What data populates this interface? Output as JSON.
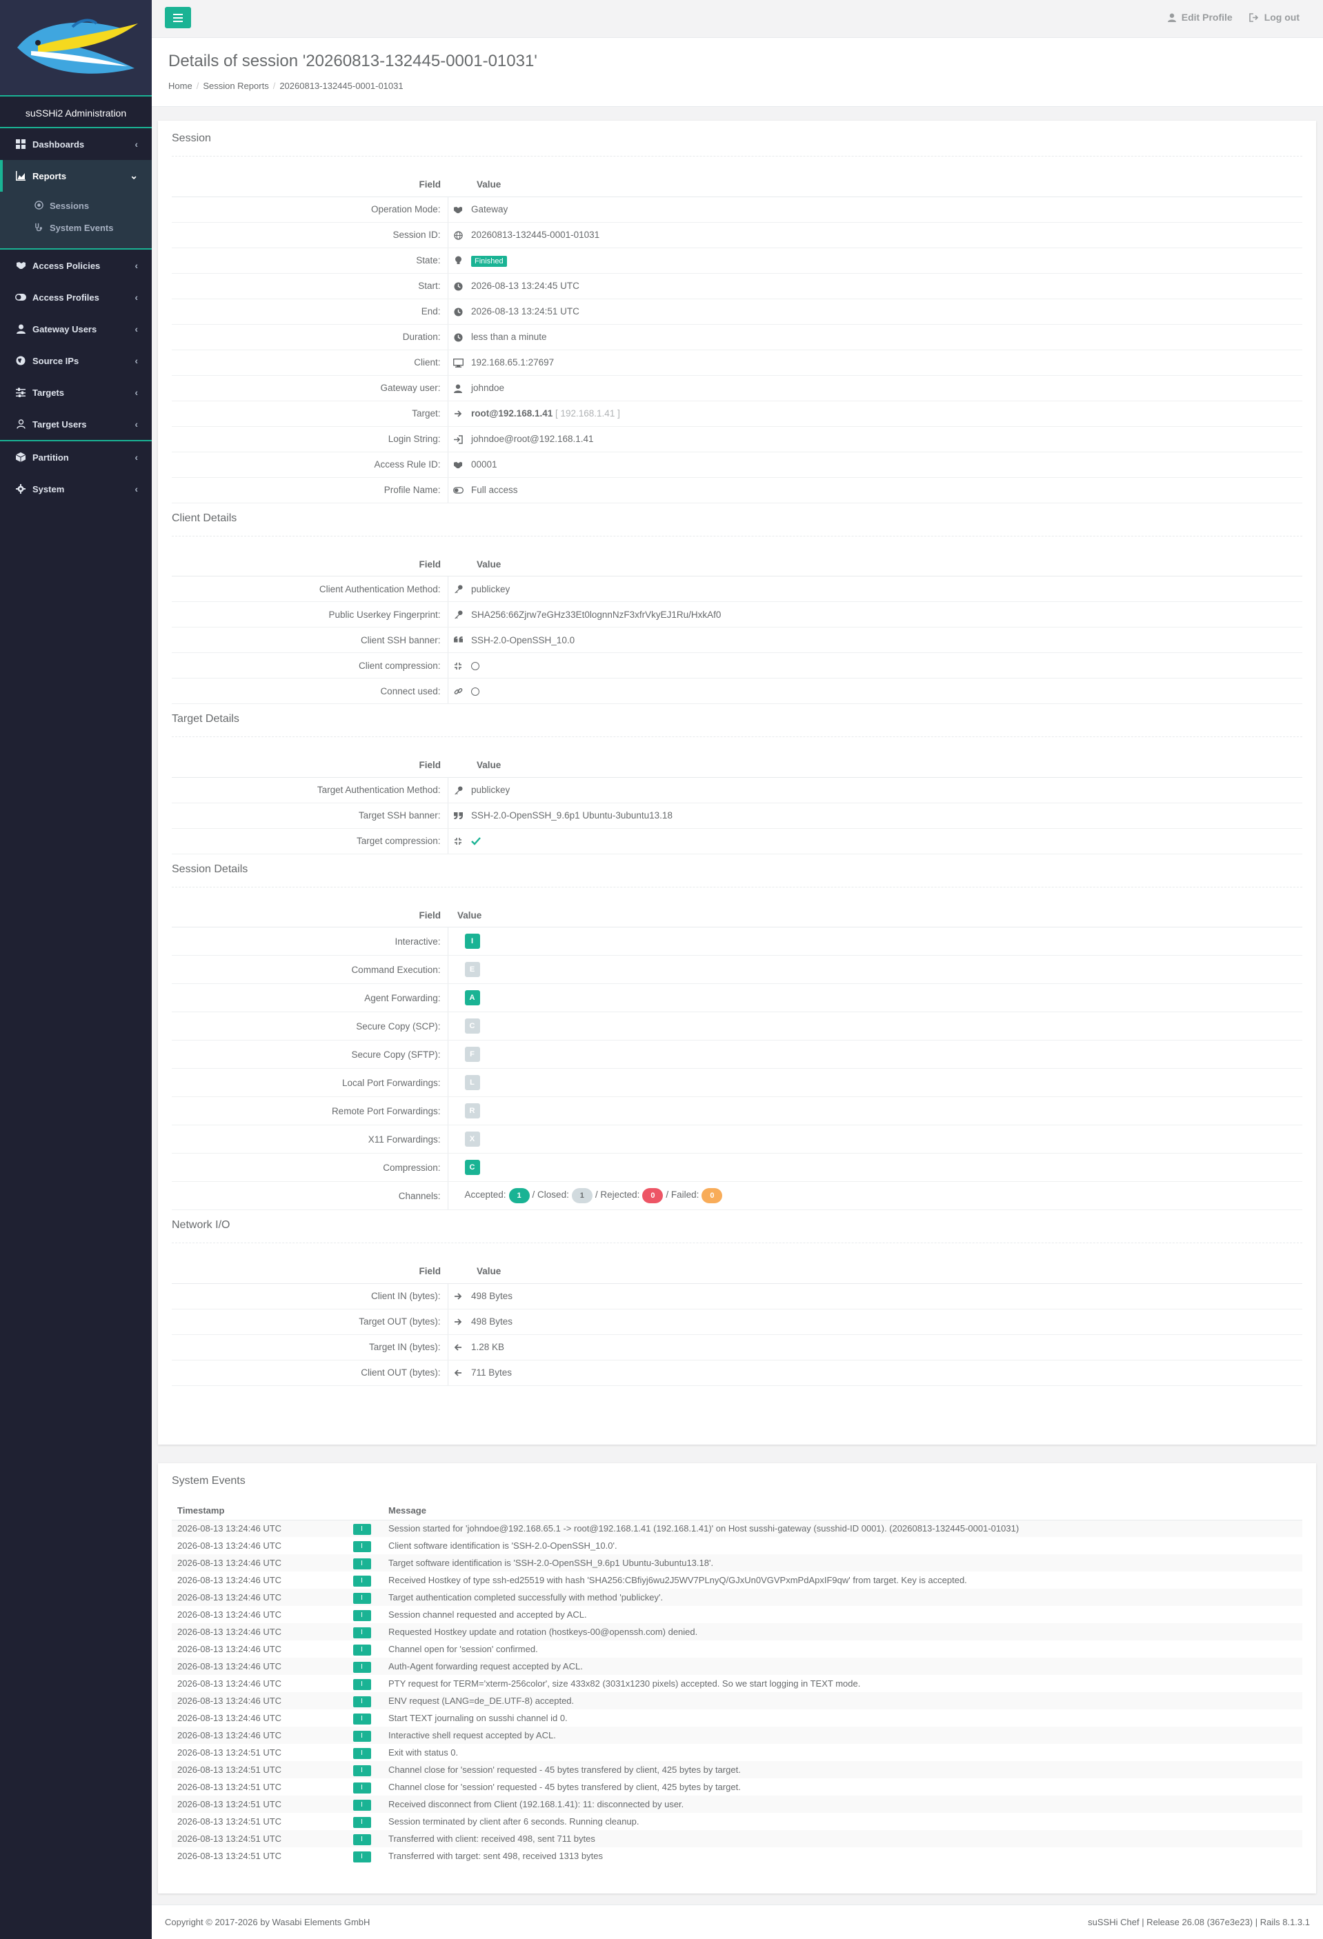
{
  "sidebar": {
    "admin_title": "suSSHi2 Administration",
    "items": {
      "dashboards": "Dashboards",
      "reports": "Reports",
      "sessions": "Sessions",
      "system_events": "System Events",
      "access_policies": "Access Policies",
      "access_profiles": "Access Profiles",
      "gateway_users": "Gateway Users",
      "source_ips": "Source IPs",
      "targets": "Targets",
      "target_users": "Target Users",
      "partition": "Partition",
      "system": "System"
    }
  },
  "topbar": {
    "edit_profile": "Edit Profile",
    "logout": "Log out"
  },
  "heading": {
    "title": "Details of session '20260813-132445-0001-01031'",
    "breadcrumb": [
      "Home",
      "Session Reports",
      "20260813-132445-0001-01031"
    ]
  },
  "table_headers": {
    "field": "Field",
    "value": "Value"
  },
  "session": {
    "title": "Session",
    "rows": [
      {
        "field": "Operation Mode:",
        "value": "Gateway"
      },
      {
        "field": "Session ID:",
        "value": "20260813-132445-0001-01031"
      },
      {
        "field": "State:",
        "value": "Finished"
      },
      {
        "field": "Start:",
        "value": "2026-08-13 13:24:45 UTC"
      },
      {
        "field": "End:",
        "value": "2026-08-13 13:24:51 UTC"
      },
      {
        "field": "Duration:",
        "value": "less than a minute"
      },
      {
        "field": "Client:",
        "value": "192.168.65.1:27697"
      },
      {
        "field": "Gateway user:",
        "value": "johndoe"
      },
      {
        "field": "Target:",
        "value": "root@192.168.1.41",
        "extra": "[ 192.168.1.41 ]"
      },
      {
        "field": "Login String:",
        "value": "johndoe@root@192.168.1.41"
      },
      {
        "field": "Access Rule ID:",
        "value": "00001"
      },
      {
        "field": "Profile Name:",
        "value": "Full access"
      }
    ]
  },
  "client_details": {
    "title": "Client Details",
    "rows": [
      {
        "field": "Client Authentication Method:",
        "value": "publickey"
      },
      {
        "field": "Public Userkey Fingerprint:",
        "value": "SHA256:66Zjrw7eGHz33Et0lognnNzF3xfrVkyEJ1Ru/HxkAf0"
      },
      {
        "field": "Client SSH banner:",
        "value": "SSH-2.0-OpenSSH_10.0"
      },
      {
        "field": "Client compression:",
        "value": ""
      },
      {
        "field": "Connect used:",
        "value": ""
      }
    ]
  },
  "target_details": {
    "title": "Target Details",
    "rows": [
      {
        "field": "Target Authentication Method:",
        "value": "publickey"
      },
      {
        "field": "Target SSH banner:",
        "value": "SSH-2.0-OpenSSH_9.6p1 Ubuntu-3ubuntu13.18"
      },
      {
        "field": "Target compression:",
        "value": ""
      }
    ]
  },
  "session_details": {
    "title": "Session Details",
    "rows": [
      {
        "field": "Interactive:",
        "flag": "I",
        "active": true
      },
      {
        "field": "Command Execution:",
        "flag": "E",
        "active": false
      },
      {
        "field": "Agent Forwarding:",
        "flag": "A",
        "active": true
      },
      {
        "field": "Secure Copy (SCP):",
        "flag": "C",
        "active": false
      },
      {
        "field": "Secure Copy (SFTP):",
        "flag": "F",
        "active": false
      },
      {
        "field": "Local Port Forwardings:",
        "flag": "L",
        "active": false
      },
      {
        "field": "Remote Port Forwardings:",
        "flag": "R",
        "active": false
      },
      {
        "field": "X11 Forwardings:",
        "flag": "X",
        "active": false
      },
      {
        "field": "Compression:",
        "flag": "C",
        "active": true
      }
    ],
    "channels": {
      "field": "Channels:",
      "accepted_label": "Accepted:",
      "accepted": "1",
      "closed_label": "/ Closed:",
      "closed": "1",
      "rejected_label": "/ Rejected:",
      "rejected": "0",
      "failed_label": "/ Failed:",
      "failed": "0"
    }
  },
  "network_io": {
    "title": "Network I/O",
    "rows": [
      {
        "field": "Client IN (bytes):",
        "value": "498 Bytes"
      },
      {
        "field": "Target OUT (bytes):",
        "value": "498 Bytes"
      },
      {
        "field": "Target IN (bytes):",
        "value": "1.28 KB"
      },
      {
        "field": "Client OUT (bytes):",
        "value": "711 Bytes"
      }
    ]
  },
  "system_events": {
    "title": "System Events",
    "headers": [
      "Timestamp",
      "",
      "Message"
    ],
    "level": "I",
    "rows": [
      [
        "2026-08-13 13:24:46 UTC",
        "Session started for 'johndoe@192.168.65.1 -> root@192.168.1.41 (192.168.1.41)' on Host susshi-gateway (susshid-ID 0001). (20260813-132445-0001-01031)"
      ],
      [
        "2026-08-13 13:24:46 UTC",
        "Client software identification is 'SSH-2.0-OpenSSH_10.0'."
      ],
      [
        "2026-08-13 13:24:46 UTC",
        "Target software identification is 'SSH-2.0-OpenSSH_9.6p1 Ubuntu-3ubuntu13.18'."
      ],
      [
        "2026-08-13 13:24:46 UTC",
        "Received Hostkey of type ssh-ed25519 with hash 'SHA256:CBfiyj6wu2J5WV7PLnyQ/GJxUn0VGVPxmPdApxIF9qw' from target. Key is accepted."
      ],
      [
        "2026-08-13 13:24:46 UTC",
        "Target authentication completed successfully with method 'publickey'."
      ],
      [
        "2026-08-13 13:24:46 UTC",
        "Session channel requested and accepted by ACL."
      ],
      [
        "2026-08-13 13:24:46 UTC",
        "Requested Hostkey update and rotation (hostkeys-00@openssh.com) denied."
      ],
      [
        "2026-08-13 13:24:46 UTC",
        "Channel open for 'session' confirmed."
      ],
      [
        "2026-08-13 13:24:46 UTC",
        "Auth-Agent forwarding request accepted by ACL."
      ],
      [
        "2026-08-13 13:24:46 UTC",
        "PTY request for TERM='xterm-256color', size 433x82 (3031x1230 pixels) accepted. So we start logging in TEXT mode."
      ],
      [
        "2026-08-13 13:24:46 UTC",
        "ENV request (LANG=de_DE.UTF-8) accepted."
      ],
      [
        "2026-08-13 13:24:46 UTC",
        "Start TEXT journaling on susshi channel id 0."
      ],
      [
        "2026-08-13 13:24:46 UTC",
        "Interactive shell request accepted by ACL."
      ],
      [
        "2026-08-13 13:24:51 UTC",
        "Exit with status 0."
      ],
      [
        "2026-08-13 13:24:51 UTC",
        "Channel close for 'session' requested - 45 bytes transfered by client, 425 bytes by target."
      ],
      [
        "2026-08-13 13:24:51 UTC",
        "Channel close for 'session' requested - 45 bytes transfered by client, 425 bytes by target."
      ],
      [
        "2026-08-13 13:24:51 UTC",
        "Received disconnect from Client (192.168.1.41): 11: disconnected by user."
      ],
      [
        "2026-08-13 13:24:51 UTC",
        "Session terminated by client after 6 seconds. Running cleanup."
      ],
      [
        "2026-08-13 13:24:51 UTC",
        "Transferred with client: received 498, sent 711 bytes"
      ],
      [
        "2026-08-13 13:24:51 UTC",
        "Transferred with target: sent 498, received 1313 bytes"
      ]
    ]
  },
  "footer": {
    "copyright": "Copyright © 2017-2026 by Wasabi Elements GmbH",
    "release": "suSSHi Chef | Release 26.08 (367e3e23) | Rails 8.1.3.1"
  },
  "colors": {
    "accent": "#1ab394",
    "sidebar": "#1f2132",
    "danger": "#ed5565",
    "warning": "#f8ac59"
  }
}
